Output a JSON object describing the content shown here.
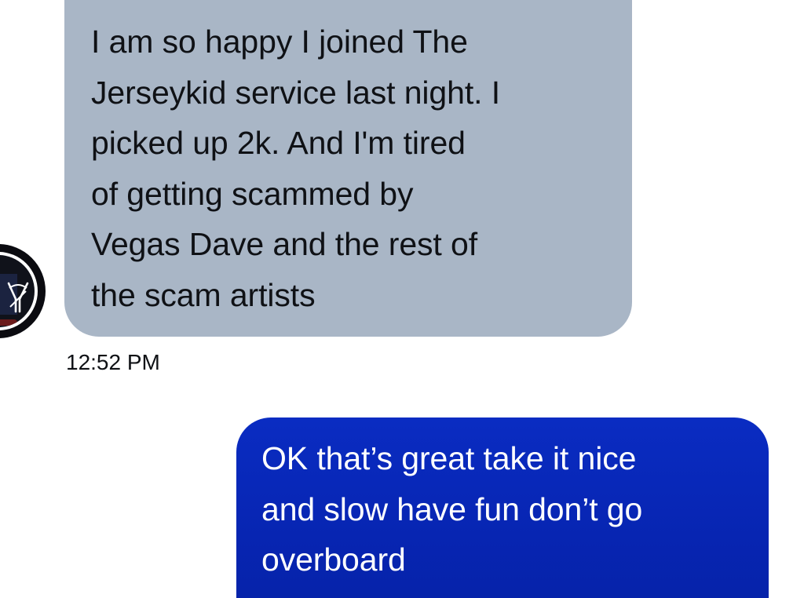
{
  "conversation": {
    "contact_avatar": {
      "logo_icon": "ny-yankees-logo"
    },
    "messages": [
      {
        "direction": "incoming",
        "text": "I am so happy I joined The\nJerseykid service last night. I\npicked up 2k.  And I'm tired\nof getting scammed by\nVegas Dave and the rest of\nthe scam artists",
        "time": "12:52 PM",
        "bubble_color": "#a9b6c6"
      },
      {
        "direction": "outgoing",
        "text": "OK that’s great take it nice\nand slow have fun don’t go\noverboard",
        "bubble_color": "#0a2cc2"
      }
    ]
  }
}
